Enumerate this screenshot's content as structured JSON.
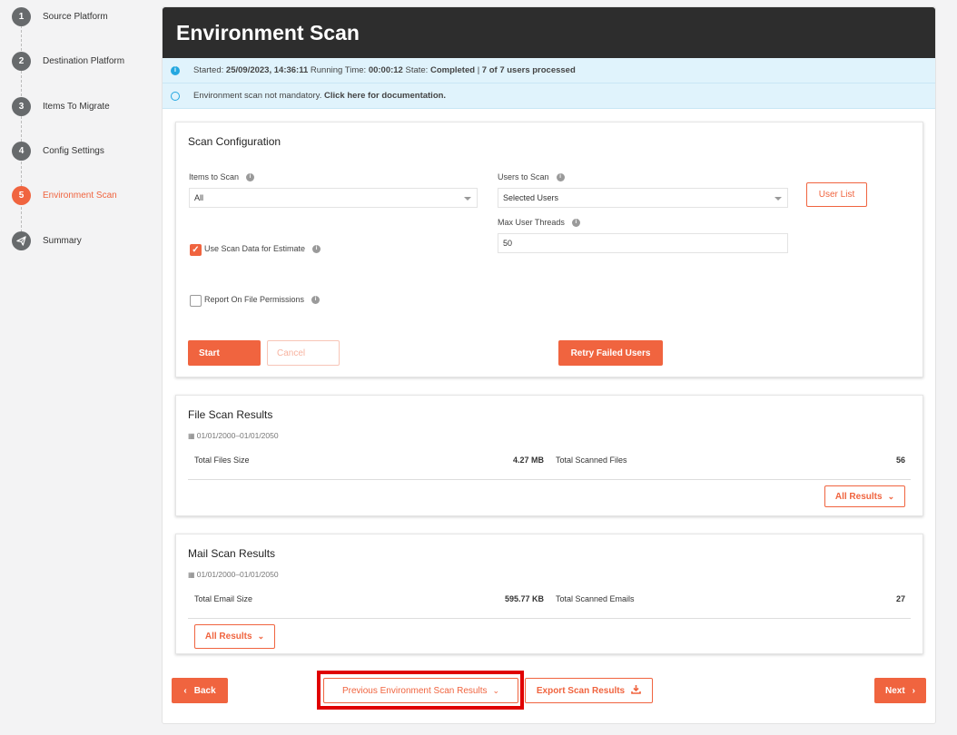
{
  "stepper": {
    "steps": [
      {
        "num": "1",
        "label": "Source Platform"
      },
      {
        "num": "2",
        "label": "Destination Platform"
      },
      {
        "num": "3",
        "label": "Items To Migrate"
      },
      {
        "num": "4",
        "label": "Config Settings"
      },
      {
        "num": "5",
        "label": "Environment Scan",
        "active": true
      },
      {
        "num": "",
        "label": "Summary",
        "icon": "paper-plane-icon"
      }
    ]
  },
  "header": {
    "title": "Environment Scan"
  },
  "status": {
    "started_label": "Started:",
    "started_value": "25/09/2023, 14:36:11",
    "running_label": "Running Time:",
    "running_value": "00:00:12",
    "state_label": "State:",
    "state_value": "Completed",
    "users_processed": "7 of 7 users processed",
    "separator": "|"
  },
  "notice": {
    "text": "Environment scan not mandatory.",
    "link": "Click here for documentation."
  },
  "scan_config": {
    "title": "Scan Configuration",
    "items_label": "Items to Scan",
    "items_value": "All",
    "users_label": "Users to Scan",
    "users_value": "Selected Users",
    "user_list_button": "User List",
    "threads_label": "Max User Threads",
    "threads_value": "50",
    "use_scan_data_label": "Use Scan Data for Estimate",
    "use_scan_data_checked": true,
    "report_permissions_label": "Report On File Permissions",
    "report_permissions_checked": false,
    "start_button": "Start",
    "cancel_button": "Cancel",
    "retry_button": "Retry Failed Users"
  },
  "file_results": {
    "title": "File Scan Results",
    "date_range": "01/01/2000–01/01/2050",
    "size_label": "Total Files Size",
    "size_value": "4.27 MB",
    "count_label": "Total Scanned Files",
    "count_value": "56",
    "all_results_button": "All Results"
  },
  "mail_results": {
    "title": "Mail Scan Results",
    "date_range": "01/01/2000–01/01/2050",
    "size_label": "Total Email Size",
    "size_value": "595.77 KB",
    "count_label": "Total Scanned Emails",
    "count_value": "27",
    "all_results_button": "All Results"
  },
  "footer": {
    "back_button": "Back",
    "previous_results_button": "Previous Environment Scan Results",
    "export_button": "Export Scan Results",
    "next_button": "Next"
  },
  "colors": {
    "accent": "#f0643f",
    "header_bg": "#2d2d2d",
    "info_bg": "#e0f3fc",
    "highlight": "#e00000"
  }
}
